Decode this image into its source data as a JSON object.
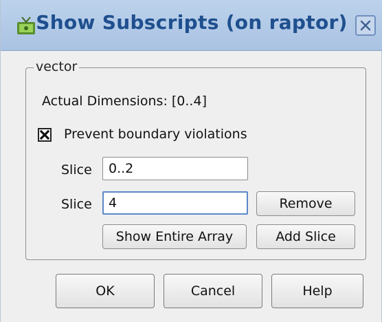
{
  "window": {
    "title": "Show Subscripts (on raptor)",
    "app_icon": "app-icon",
    "close_icon": "close-icon"
  },
  "group": {
    "label": "vector"
  },
  "dimensions_text": "Actual Dimensions: [0..4]",
  "prevent_violations": {
    "label": "Prevent boundary violations",
    "checked": true
  },
  "slices": [
    {
      "label": "Slice",
      "value": "0..2"
    },
    {
      "label": "Slice",
      "value": "4"
    }
  ],
  "buttons": {
    "remove": "Remove",
    "show_entire_array": "Show Entire Array",
    "add_slice": "Add Slice",
    "ok": "OK",
    "cancel": "Cancel",
    "help": "Help"
  },
  "colors": {
    "title_text": "#1f4f8e",
    "titlebar_bg": "#bcd2ec",
    "window_bg": "#efefef",
    "focus_border": "#5b87c9"
  }
}
